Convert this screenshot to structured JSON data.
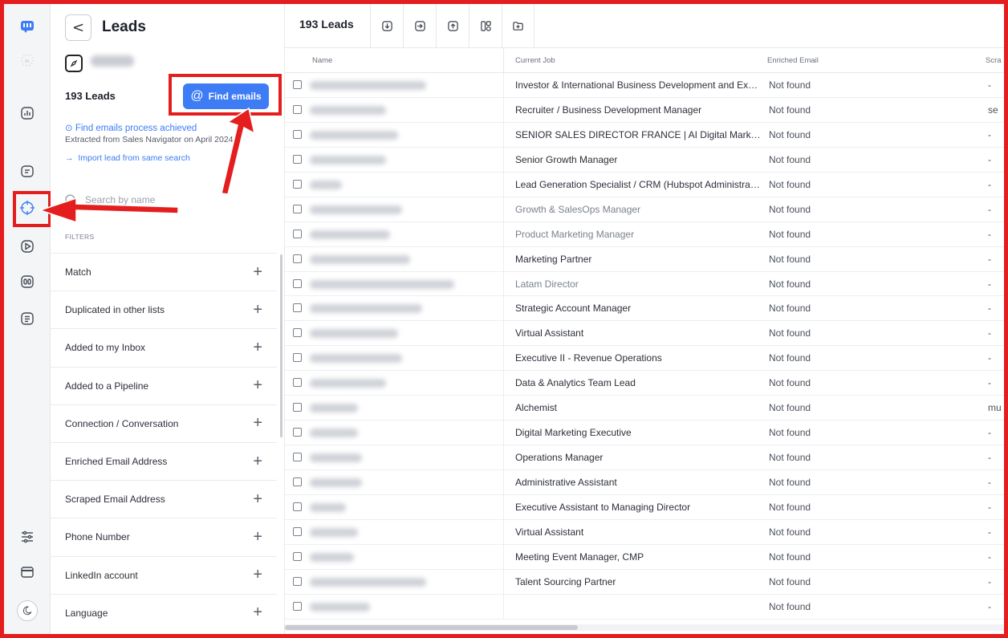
{
  "panel": {
    "back": "<",
    "title": "Leads",
    "leads_count": "193 Leads",
    "find_emails": "Find emails",
    "achieved": "Find emails process achieved",
    "extracted": "Extracted from Sales Navigator on April 2024",
    "import_link": "Import lead from same search",
    "search_placeholder": "Search by name",
    "filters_label": "FILTERS",
    "filters": [
      "Match",
      "Duplicated in other lists",
      "Added to my Inbox",
      "Added to a Pipeline",
      "Connection / Conversation",
      "Enriched Email Address",
      "Scraped Email Address",
      "Phone Number",
      "LinkedIn account",
      "Language"
    ]
  },
  "rail": {
    "icons": [
      "logo-icon",
      "linkedin-sync-icon",
      "analytics-icon",
      "inbox-icon",
      "leads-target-icon",
      "campaign-play-icon",
      "templates-icon",
      "notes-icon",
      "settings-sliders-icon",
      "billing-card-icon",
      "dark-mode-icon"
    ]
  },
  "main": {
    "count": "193 Leads",
    "toolbar_icons": [
      "export-icon",
      "move-to-list-icon",
      "import-icon",
      "copy-leads-icon",
      "new-folder-icon"
    ],
    "columns": {
      "name": "Name",
      "job": "Current Job",
      "email": "Enriched Email",
      "scraped": "Scra"
    },
    "rows": [
      {
        "job": "Investor & International Business Development and Expansion",
        "email": "Not found",
        "scraped": "-",
        "grey": false
      },
      {
        "job": "Recruiter / Business Development Manager",
        "email": "Not found",
        "scraped": "se",
        "grey": false
      },
      {
        "job": "SENIOR SALES DIRECTOR FRANCE | AI Digital Marketing",
        "email": "Not found",
        "scraped": "-",
        "grey": false
      },
      {
        "job": "Senior Growth Manager",
        "email": "Not found",
        "scraped": "-",
        "grey": false
      },
      {
        "job": "Lead Generation Specialist / CRM (Hubspot Administrator)",
        "email": "Not found",
        "scraped": "-",
        "grey": false
      },
      {
        "job": "Growth & SalesOps Manager",
        "email": "Not found",
        "scraped": "-",
        "grey": true
      },
      {
        "job": "Product Marketing Manager",
        "email": "Not found",
        "scraped": "-",
        "grey": true
      },
      {
        "job": "Marketing Partner",
        "email": "Not found",
        "scraped": "-",
        "grey": false
      },
      {
        "job": "Latam Director",
        "email": "Not found",
        "scraped": "-",
        "grey": true
      },
      {
        "job": "Strategic Account Manager",
        "email": "Not found",
        "scraped": "-",
        "grey": false
      },
      {
        "job": "Virtual Assistant",
        "email": "Not found",
        "scraped": "-",
        "grey": false
      },
      {
        "job": "Executive II - Revenue Operations",
        "email": "Not found",
        "scraped": "-",
        "grey": false
      },
      {
        "job": "Data & Analytics Team Lead",
        "email": "Not found",
        "scraped": "-",
        "grey": false
      },
      {
        "job": "Alchemist",
        "email": "Not found",
        "scraped": "mu",
        "grey": false
      },
      {
        "job": "Digital Marketing Executive",
        "email": "Not found",
        "scraped": "-",
        "grey": false
      },
      {
        "job": "Operations Manager",
        "email": "Not found",
        "scraped": "-",
        "grey": false
      },
      {
        "job": "Administrative Assistant",
        "email": "Not found",
        "scraped": "-",
        "grey": false
      },
      {
        "job": "Executive Assistant to Managing Director",
        "email": "Not found",
        "scraped": "-",
        "grey": false
      },
      {
        "job": "Virtual Assistant",
        "email": "Not found",
        "scraped": "-",
        "grey": false
      },
      {
        "job": "Meeting Event Manager, CMP",
        "email": "Not found",
        "scraped": "-",
        "grey": false
      },
      {
        "job": "Talent Sourcing Partner",
        "email": "Not found",
        "scraped": "-",
        "grey": false
      },
      {
        "job": "",
        "email": "Not found",
        "scraped": "-",
        "grey": false
      }
    ]
  },
  "colors": {
    "accent": "#3d7cf5",
    "annotation_red": "#e41e1e"
  }
}
